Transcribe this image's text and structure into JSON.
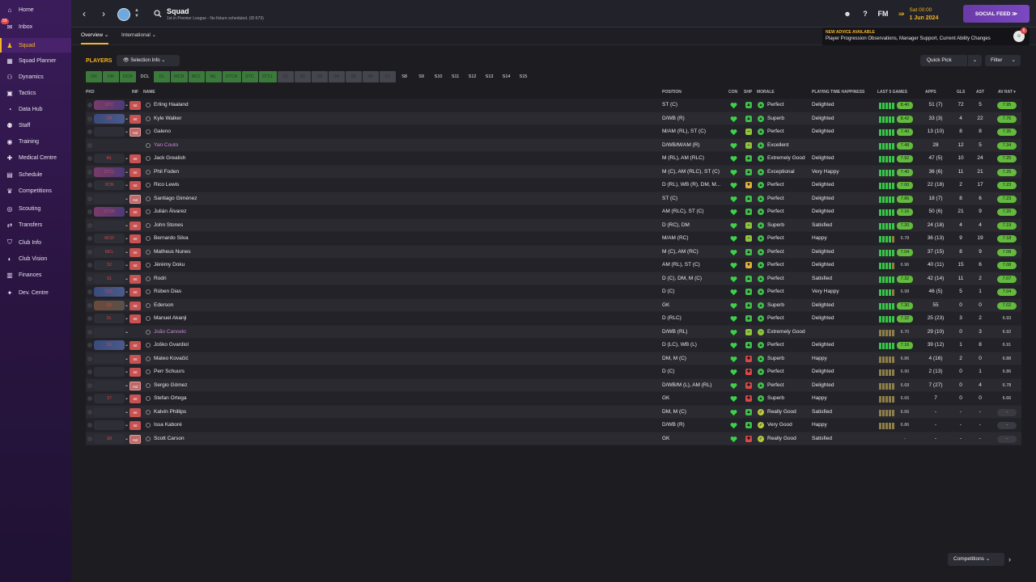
{
  "sidebar": {
    "items": [
      {
        "label": "Home",
        "icon": "home-icon",
        "glyph": "⌂"
      },
      {
        "label": "Inbox",
        "icon": "inbox-icon",
        "glyph": "✉",
        "badge": "55"
      },
      {
        "label": "Squad",
        "icon": "squad-shirt-icon",
        "glyph": "♟",
        "active": true
      },
      {
        "label": "Squad Planner",
        "icon": "squad-planner-icon",
        "glyph": "▦"
      },
      {
        "label": "Dynamics",
        "icon": "dynamics-icon",
        "glyph": "⚇"
      },
      {
        "label": "Tactics",
        "icon": "tactics-board-icon",
        "glyph": "▣"
      },
      {
        "label": "Data Hub",
        "icon": "data-hub-icon",
        "glyph": "◔"
      },
      {
        "label": "Staff",
        "icon": "staff-icon",
        "glyph": "⚉"
      },
      {
        "label": "Training",
        "icon": "training-whistle-icon",
        "glyph": "◉"
      },
      {
        "label": "Medical Centre",
        "icon": "medical-cross-icon",
        "glyph": "✚"
      },
      {
        "label": "Schedule",
        "icon": "schedule-calendar-icon",
        "glyph": "▤"
      },
      {
        "label": "Competitions",
        "icon": "competitions-trophy-icon",
        "glyph": "♛"
      },
      {
        "label": "Scouting",
        "icon": "scouting-icon",
        "glyph": "◎"
      },
      {
        "label": "Transfers",
        "icon": "transfers-icon",
        "glyph": "⇄"
      },
      {
        "label": "Club Info",
        "icon": "club-info-shield-icon",
        "glyph": "⛉"
      },
      {
        "label": "Club Vision",
        "icon": "club-vision-icon",
        "glyph": "◐"
      },
      {
        "label": "Finances",
        "icon": "finances-icon",
        "glyph": "▥"
      },
      {
        "label": "Dev. Centre",
        "icon": "dev-centre-icon",
        "glyph": "✦"
      }
    ]
  },
  "topbar": {
    "title": "Squad",
    "subtitle": "1st in Premier League - No fixture scheduled. (ID:679)",
    "fm_label": "FM",
    "date_day": "Sat 00:00",
    "date_value": "1 Jun 2024",
    "social_feed": "SOCIAL FEED  ≫"
  },
  "subtabs": {
    "overview": "Overview ⌄",
    "international": "International ⌄"
  },
  "advice": {
    "title": "NEW ADVICE AVAILABLE",
    "text": "Player Progression Observations, Manager Support, Current Ability Changes",
    "badge": "6"
  },
  "players_label": "PLAYERS",
  "selection_info": "👁 Selection Info ⌄",
  "quick_pick": "Quick Pick",
  "filter": "Filter",
  "position_tabs": [
    {
      "label": "GK",
      "style": "green"
    },
    {
      "label": "DR",
      "style": "green"
    },
    {
      "label": "DCR",
      "style": "green"
    },
    {
      "label": "DCL",
      "style": "dark"
    },
    {
      "label": "DL",
      "style": "green"
    },
    {
      "label": "MCR",
      "style": "green"
    },
    {
      "label": "MCL",
      "style": "green"
    },
    {
      "label": "ML",
      "style": "green"
    },
    {
      "label": "STCR",
      "style": "green"
    },
    {
      "label": "STC",
      "style": "green"
    },
    {
      "label": "STCL",
      "style": "green"
    },
    {
      "label": "S1",
      "style": "grey"
    },
    {
      "label": "S2",
      "style": "grey"
    },
    {
      "label": "S3",
      "style": "grey"
    },
    {
      "label": "S4",
      "style": "grey"
    },
    {
      "label": "S5",
      "style": "grey"
    },
    {
      "label": "S6",
      "style": "grey"
    },
    {
      "label": "S7",
      "style": "grey"
    },
    {
      "label": "S8",
      "style": "dark"
    },
    {
      "label": "S9",
      "style": "dark"
    },
    {
      "label": "S10",
      "style": "dark"
    },
    {
      "label": "S11",
      "style": "dark"
    },
    {
      "label": "S12",
      "style": "dark"
    },
    {
      "label": "S13",
      "style": "dark"
    },
    {
      "label": "S14",
      "style": "dark"
    },
    {
      "label": "S15",
      "style": "dark"
    }
  ],
  "columns": {
    "pkd": "PKD",
    "inf": "INF",
    "name": "NAME",
    "position": "POSITION",
    "con": "CON",
    "shp": "SHP",
    "morale": "MORALE",
    "pth": "PLAYING TIME HAPPINESS",
    "last5": "LAST 5 GAMES",
    "apps": "APPS",
    "gls": "GLS",
    "ast": "AST",
    "avrat": "AV RAT ▾"
  },
  "colors": {
    "accent": "#f5b428",
    "good": "#62bb3c",
    "bad": "#e04848",
    "purple": "#7a48c0"
  },
  "players": [
    {
      "name": "Erling Haaland",
      "pos": "ST (C)",
      "sel": "STC",
      "pill": "r",
      "inf": "Int",
      "shp": "up",
      "mor": "up",
      "morale": "Perfect",
      "pth": "Delighted",
      "bars": "ggggg",
      "l5": "8.40",
      "l5g": true,
      "apps": "51 (7)",
      "gls": "72",
      "ast": "5",
      "av": "7.95",
      "avg": true
    },
    {
      "name": "Kyle Walker",
      "pos": "D/WB (R)",
      "sel": "DR",
      "pill": "b",
      "inf": "Int",
      "shp": "up",
      "mor": "up",
      "morale": "Superb",
      "pth": "Delighted",
      "bars": "ggggg",
      "l5": "8.42",
      "l5g": true,
      "apps": "33 (3)",
      "gls": "4",
      "ast": "22",
      "av": "7.76",
      "avg": true
    },
    {
      "name": "Galeno",
      "pos": "M/AM (RL), ST (C)",
      "sel": "",
      "pill": "",
      "inf": "Hol",
      "shp": "eq",
      "mor": "up",
      "morale": "Perfect",
      "pth": "Delighted",
      "bars": "ggggg",
      "l5": "7.40",
      "l5g": true,
      "apps": "13 (10)",
      "gls": "8",
      "ast": "8",
      "av": "7.35",
      "avg": true
    },
    {
      "name": "Yan Couto",
      "pos": "D/WB/M/AM (R)",
      "sel": "",
      "pill": "none",
      "inf": "",
      "loan": true,
      "shp": "eq",
      "mor": "up",
      "morale": "Excellent",
      "pth": "",
      "bars": "ggggg",
      "l5": "7.48",
      "l5g": true,
      "apps": "28",
      "gls": "12",
      "ast": "5",
      "av": "7.34",
      "avg": true
    },
    {
      "name": "Jack Grealish",
      "pos": "M (RL), AM (RLC)",
      "sel": "ML",
      "pill": "",
      "inf": "Int",
      "shp": "up",
      "mor": "up",
      "morale": "Extremely Good",
      "pth": "Delighted",
      "bars": "ggggg",
      "l5": "7.92",
      "l5g": true,
      "apps": "47 (5)",
      "gls": "10",
      "ast": "24",
      "av": "7.25",
      "avg": true
    },
    {
      "name": "Phil Foden",
      "pos": "M (C), AM (RLC), ST (C)",
      "sel": "STCL",
      "pill": "r",
      "inf": "Int",
      "shp": "up",
      "mor": "up",
      "morale": "Exceptional",
      "pth": "Very Happy",
      "bars": "ggggg",
      "l5": "7.40",
      "l5g": true,
      "apps": "36 (6)",
      "gls": "11",
      "ast": "21",
      "av": "7.25",
      "avg": true
    },
    {
      "name": "Rico Lewis",
      "pos": "D (RL), WB (R), DM, M...",
      "sel": "DCR",
      "pill": "",
      "inf": "Int",
      "shp": "warn",
      "mor": "up",
      "morale": "Perfect",
      "pth": "Delighted",
      "bars": "ggggg",
      "l5": "7.00",
      "l5g": true,
      "apps": "22 (18)",
      "gls": "2",
      "ast": "17",
      "av": "7.23",
      "avg": true
    },
    {
      "name": "Santiago Giménez",
      "pos": "ST (C)",
      "sel": "",
      "pill": "",
      "inf": "Hol",
      "shp": "up",
      "mor": "up",
      "morale": "Perfect",
      "pth": "Delighted",
      "bars": "ggggg",
      "l5": "7.86",
      "l5g": true,
      "apps": "18 (7)",
      "gls": "8",
      "ast": "6",
      "av": "7.23",
      "avg": true
    },
    {
      "name": "Julián Álvarez",
      "pos": "AM (RLC), ST (C)",
      "sel": "STCR",
      "pill": "r",
      "inf": "Int",
      "shp": "up",
      "mor": "up",
      "morale": "Perfect",
      "pth": "Delighted",
      "bars": "ggggg",
      "l5": "7.16",
      "l5g": true,
      "apps": "50 (6)",
      "gls": "21",
      "ast": "9",
      "av": "7.20",
      "avg": true
    },
    {
      "name": "John Stones",
      "pos": "D (RC), DM",
      "sel": "",
      "pill": "",
      "inf": "Int",
      "shp": "eq",
      "mor": "up",
      "morale": "Superb",
      "pth": "Satisfied",
      "bars": "ggggg",
      "l5": "7.20",
      "l5g": true,
      "apps": "24 (18)",
      "gls": "4",
      "ast": "4",
      "av": "7.19",
      "avg": true
    },
    {
      "name": "Bernardo Silva",
      "pos": "M/AM (RC)",
      "sel": "MCR",
      "pill": "",
      "inf": "Int",
      "shp": "eq",
      "mor": "up",
      "morale": "Perfect",
      "pth": "Happy",
      "bars": "ggggm",
      "l5": "6.78",
      "l5g": false,
      "apps": "36 (13)",
      "gls": "9",
      "ast": "19",
      "av": "7.18",
      "avg": true
    },
    {
      "name": "Matheus Nunes",
      "pos": "M (C), AM (RC)",
      "sel": "MCL",
      "pill": "",
      "inf": "Int",
      "shp": "up",
      "mor": "up",
      "morale": "Perfect",
      "pth": "Delighted",
      "bars": "ggggg",
      "l5": "7.04",
      "l5g": true,
      "apps": "37 (15)",
      "gls": "8",
      "ast": "9",
      "av": "7.08",
      "avg": true
    },
    {
      "name": "Jérémy Doku",
      "pos": "AM (RL), ST (C)",
      "sel": "S2",
      "pill": "",
      "inf": "Int",
      "shp": "warn",
      "mor": "up",
      "morale": "Perfect",
      "pth": "Delighted",
      "bars": "ggggm",
      "l5": "6.96",
      "l5g": false,
      "apps": "40 (11)",
      "gls": "15",
      "ast": "6",
      "av": "7.08",
      "avg": true
    },
    {
      "name": "Rodri",
      "pos": "D (C), DM, M (C)",
      "sel": "S1",
      "pill": "",
      "inf": "Int",
      "shp": "up",
      "mor": "up",
      "morale": "Perfect",
      "pth": "Satisfied",
      "bars": "ggggg",
      "l5": "7.32",
      "l5g": true,
      "apps": "42 (14)",
      "gls": "11",
      "ast": "2",
      "av": "7.07",
      "avg": true
    },
    {
      "name": "Rúben Dias",
      "pos": "D (C)",
      "sel": "DCL",
      "pill": "b",
      "inf": "Int",
      "shp": "up",
      "mor": "up",
      "morale": "Perfect",
      "pth": "Very Happy",
      "bars": "ggggm",
      "l5": "6.98",
      "l5g": false,
      "apps": "46 (5)",
      "gls": "5",
      "ast": "1",
      "av": "7.04",
      "avg": true
    },
    {
      "name": "Ederson",
      "pos": "GK",
      "sel": "GK",
      "pill": "t",
      "inf": "Int",
      "shp": "up",
      "mor": "up",
      "morale": "Superb",
      "pth": "Delighted",
      "bars": "ggggg",
      "l5": "7.30",
      "l5g": true,
      "apps": "55",
      "gls": "0",
      "ast": "0",
      "av": "7.02",
      "avg": true
    },
    {
      "name": "Manuel Akanji",
      "pos": "D (RLC)",
      "sel": "DL",
      "pill": "",
      "inf": "Int",
      "shp": "up",
      "mor": "up",
      "morale": "Perfect",
      "pth": "Delighted",
      "bars": "ggggg",
      "l5": "7.32",
      "l5g": true,
      "apps": "25 (23)",
      "gls": "3",
      "ast": "2",
      "av": "6.93",
      "avg": false
    },
    {
      "name": "João Cancelo",
      "pos": "D/WB (RL)",
      "sel": "",
      "pill": "",
      "inf": "",
      "loan": true,
      "shp": "eq",
      "mor": "eq",
      "morale": "Extremely Good",
      "pth": "",
      "bars": "mmmmm",
      "l5": "6.70",
      "l5g": false,
      "apps": "29 (10)",
      "gls": "0",
      "ast": "3",
      "av": "6.92",
      "avg": false
    },
    {
      "name": "Joško Gvardiol",
      "pos": "D (LC), WB (L)",
      "sel": "S3",
      "pill": "b",
      "inf": "Int",
      "shp": "up",
      "mor": "up",
      "morale": "Perfect",
      "pth": "Delighted",
      "bars": "ggggg",
      "l5": "7.16",
      "l5g": true,
      "apps": "39 (12)",
      "gls": "1",
      "ast": "8",
      "av": "6.91",
      "avg": false
    },
    {
      "name": "Mateo Kovačić",
      "pos": "DM, M (C)",
      "sel": "",
      "pill": "",
      "inf": "Int",
      "shp": "down",
      "mor": "up",
      "morale": "Superb",
      "pth": "Happy",
      "bars": "mmmmm",
      "l5": "6.86",
      "l5g": false,
      "apps": "4 (16)",
      "gls": "2",
      "ast": "0",
      "av": "6.88",
      "avg": false
    },
    {
      "name": "Perr Schuurs",
      "pos": "D (C)",
      "sel": "",
      "pill": "",
      "inf": "Int",
      "shp": "down",
      "mor": "up",
      "morale": "Perfect",
      "pth": "Delighted",
      "bars": "mmmmm",
      "l5": "6.90",
      "l5g": false,
      "apps": "2 (13)",
      "gls": "0",
      "ast": "1",
      "av": "6.86",
      "avg": false
    },
    {
      "name": "Sergio Gómez",
      "pos": "D/WB/M (L), AM (RL)",
      "sel": "",
      "pill": "",
      "inf": "Hol",
      "shp": "down",
      "mor": "up",
      "morale": "Perfect",
      "pth": "Delighted",
      "bars": "mmmmm",
      "l5": "6.68",
      "l5g": false,
      "apps": "7 (27)",
      "gls": "0",
      "ast": "4",
      "av": "6.78",
      "avg": false
    },
    {
      "name": "Stefan Ortega",
      "pos": "GK",
      "sel": "S7",
      "pill": "",
      "inf": "Int",
      "shp": "down",
      "mor": "up",
      "morale": "Superb",
      "pth": "Happy",
      "bars": "mmmmm",
      "l5": "6.66",
      "l5g": false,
      "apps": "7",
      "gls": "0",
      "ast": "0",
      "av": "6.66",
      "avg": false
    },
    {
      "name": "Kalvin Phillips",
      "pos": "DM, M (C)",
      "sel": "",
      "pill": "",
      "inf": "Int",
      "shp": "up",
      "mor": "ok",
      "morale": "Really Good",
      "pth": "Satisfied",
      "bars": "mmmmm",
      "l5": "6.66",
      "l5g": false,
      "apps": "-",
      "gls": "-",
      "ast": "-",
      "av": "-",
      "avg": false,
      "ave": true
    },
    {
      "name": "Issa Kaboré",
      "pos": "D/WB (R)",
      "sel": "",
      "pill": "",
      "inf": "Int",
      "shp": "up",
      "mor": "ok",
      "morale": "Very Good",
      "pth": "Happy",
      "bars": "mmmmm",
      "l5": "6.86",
      "l5g": false,
      "apps": "-",
      "gls": "-",
      "ast": "-",
      "av": "-",
      "avg": false,
      "ave": true
    },
    {
      "name": "Scott Carson",
      "pos": "GK",
      "sel": "S8",
      "pill": "",
      "inf": "Hol",
      "shp": "down",
      "mor": "ok",
      "morale": "Really Good",
      "pth": "Satisfied",
      "bars": "",
      "l5": "-",
      "l5g": false,
      "apps": "-",
      "gls": "-",
      "ast": "-",
      "av": "-",
      "avg": false,
      "ave": true
    }
  ],
  "competitions": "Competitions ⌄"
}
